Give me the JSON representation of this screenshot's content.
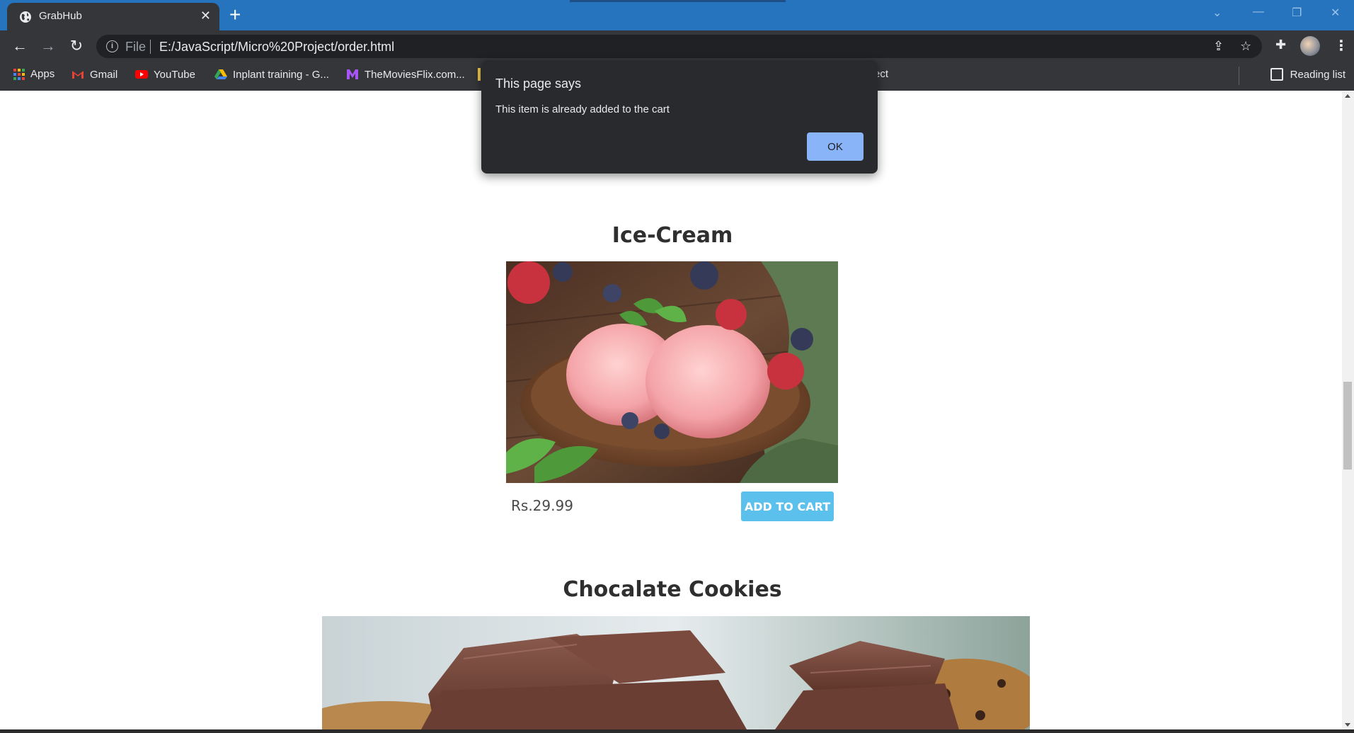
{
  "browser": {
    "tab_title": "GrabHub",
    "url_scheme": "File",
    "url": "E:/JavaScript/Micro%20Project/order.html",
    "bookmarks": [
      {
        "label": "Apps",
        "icon": "apps-grid-icon"
      },
      {
        "label": "Gmail",
        "icon": "gmail-icon"
      },
      {
        "label": "YouTube",
        "icon": "youtube-icon"
      },
      {
        "label": "Inplant training - G...",
        "icon": "google-drive-icon"
      },
      {
        "label": "TheMoviesFlix.com...",
        "icon": "moviesflix-icon"
      }
    ],
    "bookmark_clipped_text": "ect",
    "reading_list": "Reading list"
  },
  "dialog": {
    "title": "This page says",
    "message": "This item is already added to the cart",
    "ok_label": "OK"
  },
  "products": [
    {
      "name": "Ice-Cream",
      "price": "Rs.29.99",
      "button": "ADD TO CART",
      "image": "strawberry-ice-cream-bowl"
    },
    {
      "name": "Chocalate Cookies",
      "image": "chocolate-cookies"
    }
  ],
  "colors": {
    "title_bar": "#2574bd",
    "chrome_dark": "#35363a",
    "dialog_bg": "#292a2d",
    "ok_button": "#8ab4f8",
    "add_to_cart": "#5bc0eb"
  }
}
